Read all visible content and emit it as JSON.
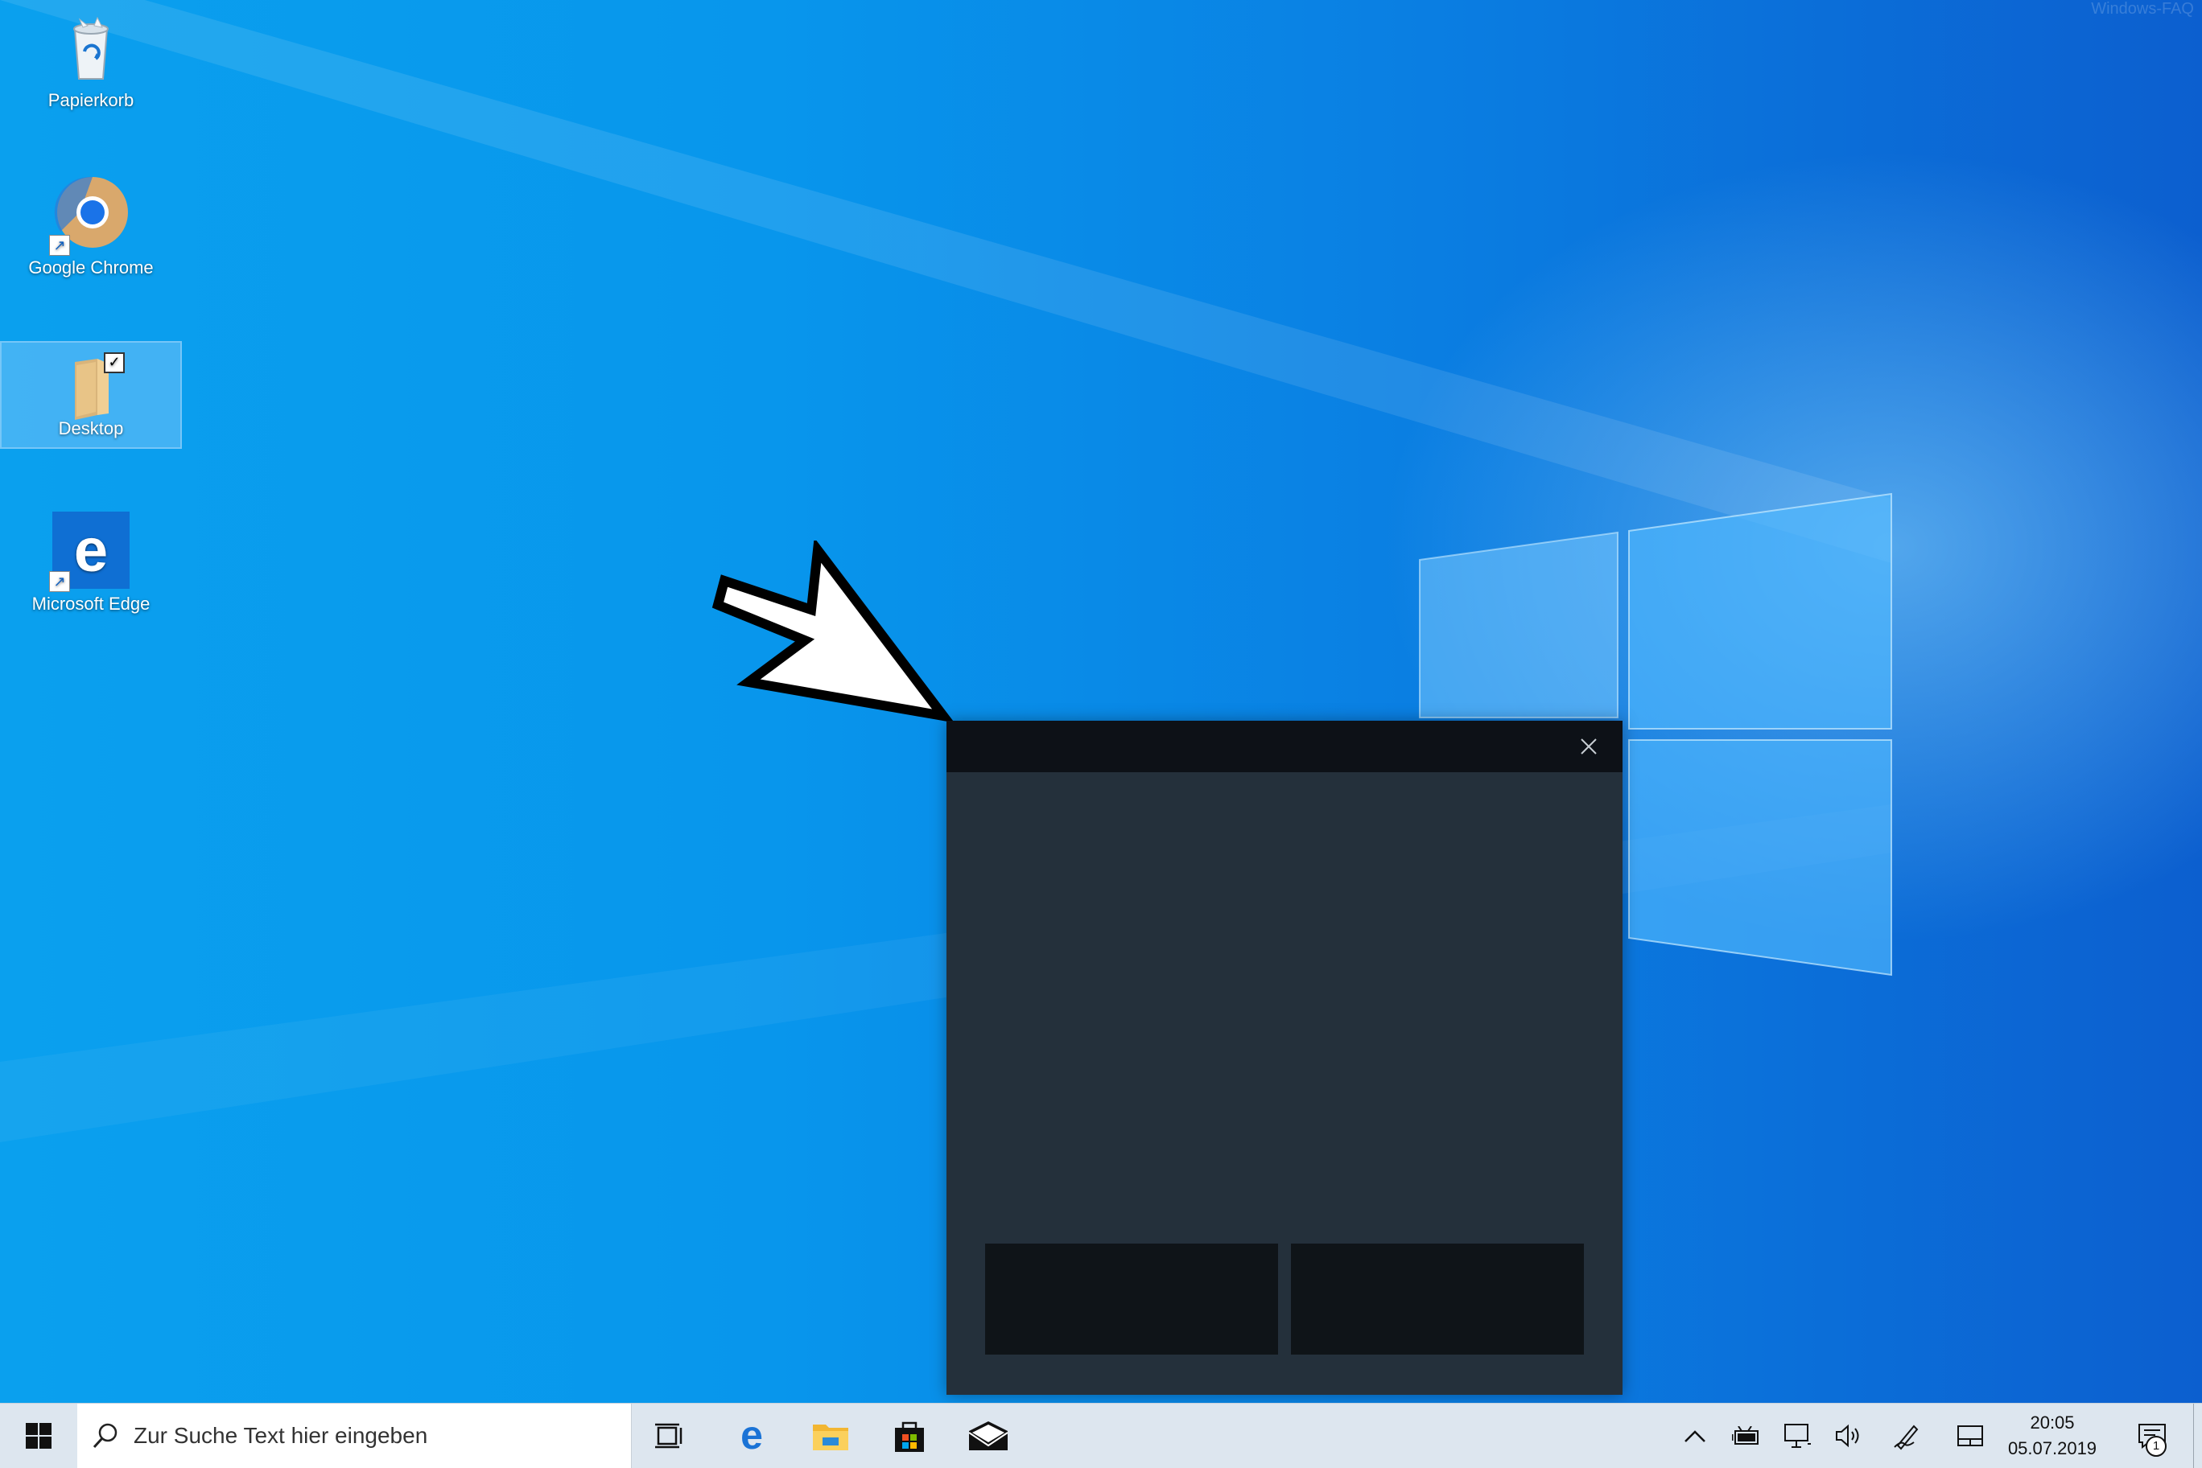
{
  "desktop": {
    "watermark": "Windows-FAQ",
    "icons": [
      {
        "label": "Papierkorb",
        "icon": "recycle-bin-icon"
      },
      {
        "label": "Google Chrome",
        "icon": "chrome-icon"
      },
      {
        "label": "Desktop",
        "icon": "folder-icon",
        "selected": true
      },
      {
        "label": "Microsoft Edge",
        "icon": "edge-icon"
      }
    ]
  },
  "touchpad_window": {
    "close_icon": "close-icon",
    "colors": {
      "titlebar": "#0d1117",
      "surface": "#24303b",
      "buttons": "#0f1418"
    }
  },
  "taskbar": {
    "search_placeholder": "Zur Suche Text hier eingeben",
    "pinned": [
      "task-view-icon",
      "edge-icon",
      "file-explorer-icon",
      "store-icon",
      "mail-icon"
    ],
    "tray": [
      "chevron-up-icon",
      "battery-icon",
      "network-icon",
      "volume-icon",
      "pen-icon",
      "touchpad-icon"
    ],
    "time": "20:05",
    "date": "05.07.2019",
    "notification_count": "1"
  }
}
